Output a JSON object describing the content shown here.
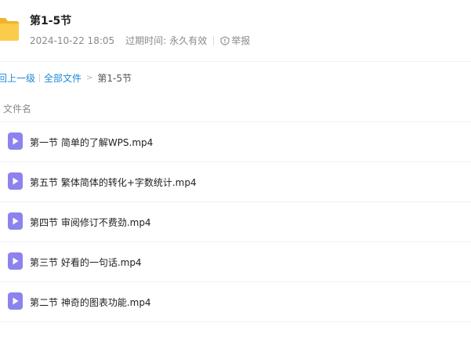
{
  "header": {
    "title": "第1-5节",
    "date": "2024-10-22 18:05",
    "expiry_label": "过期时间:",
    "expiry_value": "永久有效",
    "report_label": "举报",
    "folder_icon": "folder-icon",
    "report_icon": "report-icon"
  },
  "breadcrumb": {
    "back_label": "回上一级",
    "all_files_label": "全部文件",
    "separator": ">",
    "current": "第1-5节"
  },
  "list": {
    "column_header": "文件名",
    "file_icon": "video-file-icon",
    "files": [
      {
        "name": "第一节 简单的了解WPS.mp4"
      },
      {
        "name": "第五节 繁体简体的转化+字数统计.mp4"
      },
      {
        "name": "第四节 审阅修订不费劲.mp4"
      },
      {
        "name": "第三节 好看的一句话.mp4"
      },
      {
        "name": "第二节 神奇的图表功能.mp4"
      }
    ]
  },
  "colors": {
    "folder": "#f6c744",
    "video_icon": "#8c83ee",
    "link": "#1e88d8"
  }
}
